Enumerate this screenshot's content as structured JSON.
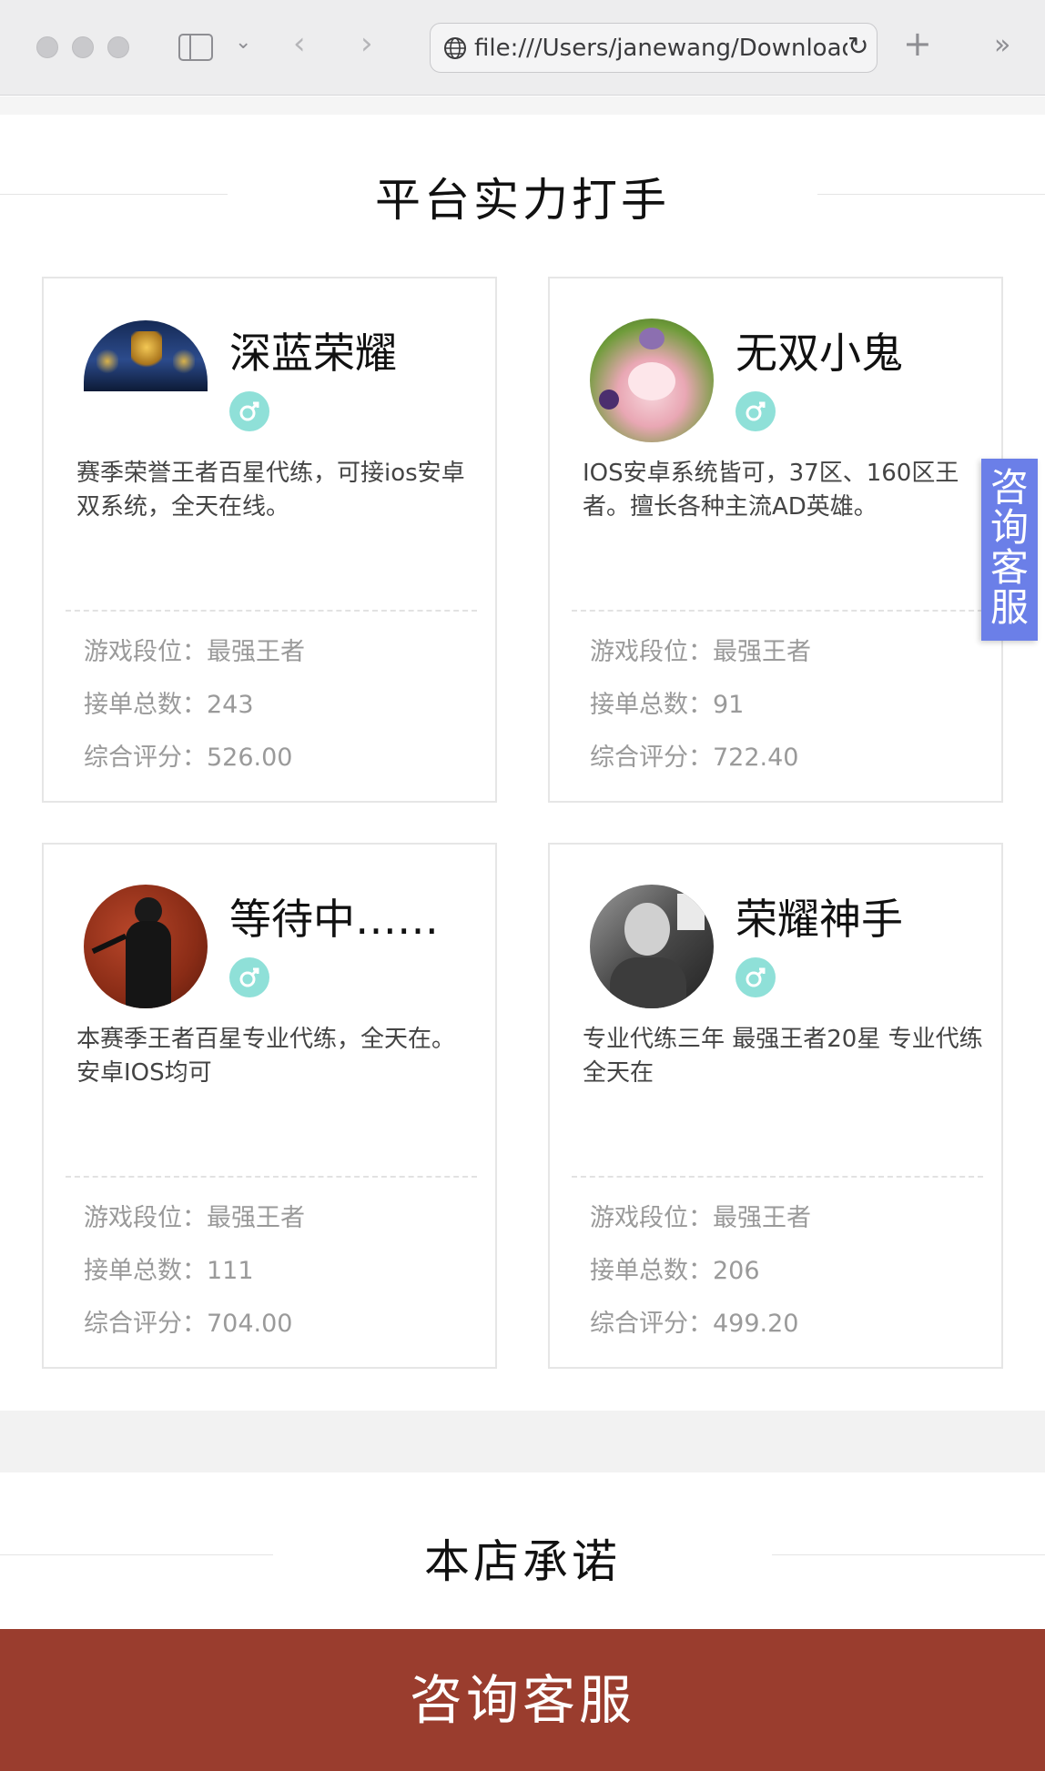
{
  "browser": {
    "url": "file:///Users/janewang/Downloads/"
  },
  "section1": {
    "title": "平台实力打手"
  },
  "section2": {
    "title": "本店承诺"
  },
  "players": [
    {
      "name": "深蓝荣耀",
      "desc": "赛季荣誉王者百星代练，可接ios安卓双系统，全天在线。",
      "rank_label": "游戏段位：",
      "rank": "最强王者",
      "orders_label": "接单总数：",
      "orders": "243",
      "score_label": "综合评分：",
      "score": "526.00",
      "gender_icon": "male-icon"
    },
    {
      "name": "无双小鬼",
      "desc": "IOS安卓系统皆可，37区、160区王者。擅长各种主流AD英雄。",
      "rank_label": "游戏段位：",
      "rank": "最强王者",
      "orders_label": "接单总数：",
      "orders": "91",
      "score_label": "综合评分：",
      "score": "722.40",
      "gender_icon": "male-icon"
    },
    {
      "name": "等待中……",
      "desc": "本赛季王者百星专业代练，全天在。安卓IOS均可",
      "rank_label": "游戏段位：",
      "rank": "最强王者",
      "orders_label": "接单总数：",
      "orders": "111",
      "score_label": "综合评分：",
      "score": "704.00",
      "gender_icon": "male-icon"
    },
    {
      "name": "荣耀神手",
      "desc": "专业代练三年 最强王者20星 专业代练全天在",
      "rank_label": "游戏段位：",
      "rank": "最强王者",
      "orders_label": "接单总数：",
      "orders": "206",
      "score_label": "综合评分：",
      "score": "499.20",
      "gender_icon": "male-icon"
    }
  ],
  "float_button": {
    "label": "咨询客服"
  },
  "bottom_button": {
    "label": "咨询客服"
  },
  "colors": {
    "accent_bottom": "#9a3d2e",
    "float_button": "#6b7fe8",
    "gender_badge": "#8fe0d8"
  }
}
